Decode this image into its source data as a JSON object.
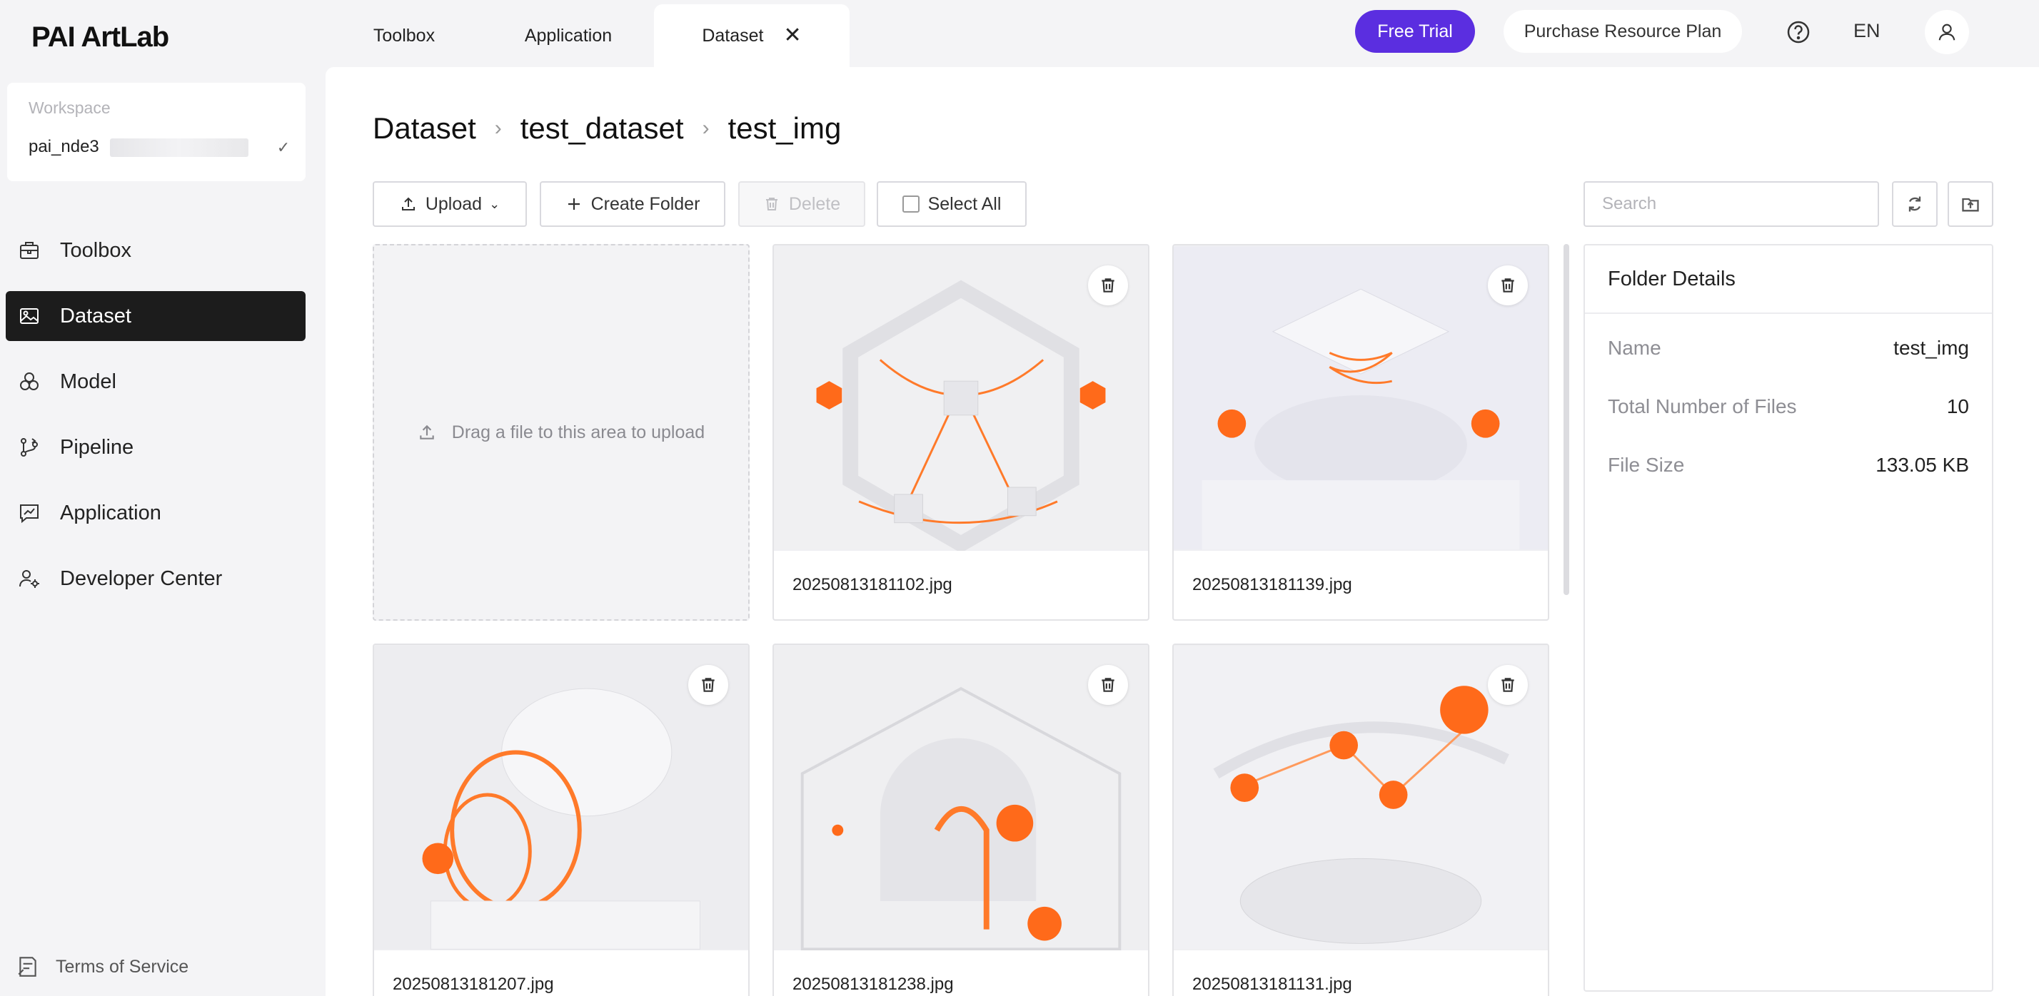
{
  "app": {
    "logo": "PAI ArtLab"
  },
  "workspace": {
    "label": "Workspace",
    "value": "pai_nde3"
  },
  "sidebar": {
    "items": [
      {
        "label": "Toolbox",
        "icon": "toolbox-icon"
      },
      {
        "label": "Dataset",
        "icon": "dataset-icon",
        "active": true
      },
      {
        "label": "Model",
        "icon": "model-icon"
      },
      {
        "label": "Pipeline",
        "icon": "pipeline-icon"
      },
      {
        "label": "Application",
        "icon": "application-icon"
      },
      {
        "label": "Developer Center",
        "icon": "developer-icon"
      }
    ],
    "terms": "Terms of Service"
  },
  "tabs": [
    {
      "label": "Toolbox"
    },
    {
      "label": "Application"
    },
    {
      "label": "Dataset",
      "active": true,
      "close": "✕"
    }
  ],
  "header": {
    "free_trial": "Free Trial",
    "purchase": "Purchase Resource Plan",
    "lang": "EN"
  },
  "breadcrumb": [
    "Dataset",
    "test_dataset",
    "test_img"
  ],
  "toolbar": {
    "upload": "Upload",
    "create_folder": "Create Folder",
    "delete": "Delete",
    "select_all": "Select All",
    "search_placeholder": "Search"
  },
  "upload_area": {
    "text": "Drag a file to this area to upload"
  },
  "files": [
    {
      "name": "20250813181102.jpg"
    },
    {
      "name": "20250813181139.jpg"
    },
    {
      "name": "20250813181207.jpg"
    },
    {
      "name": "20250813181238.jpg"
    },
    {
      "name": "20250813181131.jpg"
    }
  ],
  "details": {
    "title": "Folder Details",
    "rows": [
      {
        "key": "Name",
        "value": "test_img"
      },
      {
        "key": "Total Number of Files",
        "value": "10"
      },
      {
        "key": "File Size",
        "value": "133.05 KB"
      }
    ]
  },
  "colors": {
    "accent": "#5b2ee0",
    "orange": "#ff6a1a",
    "active_nav": "#1c1c1c"
  }
}
